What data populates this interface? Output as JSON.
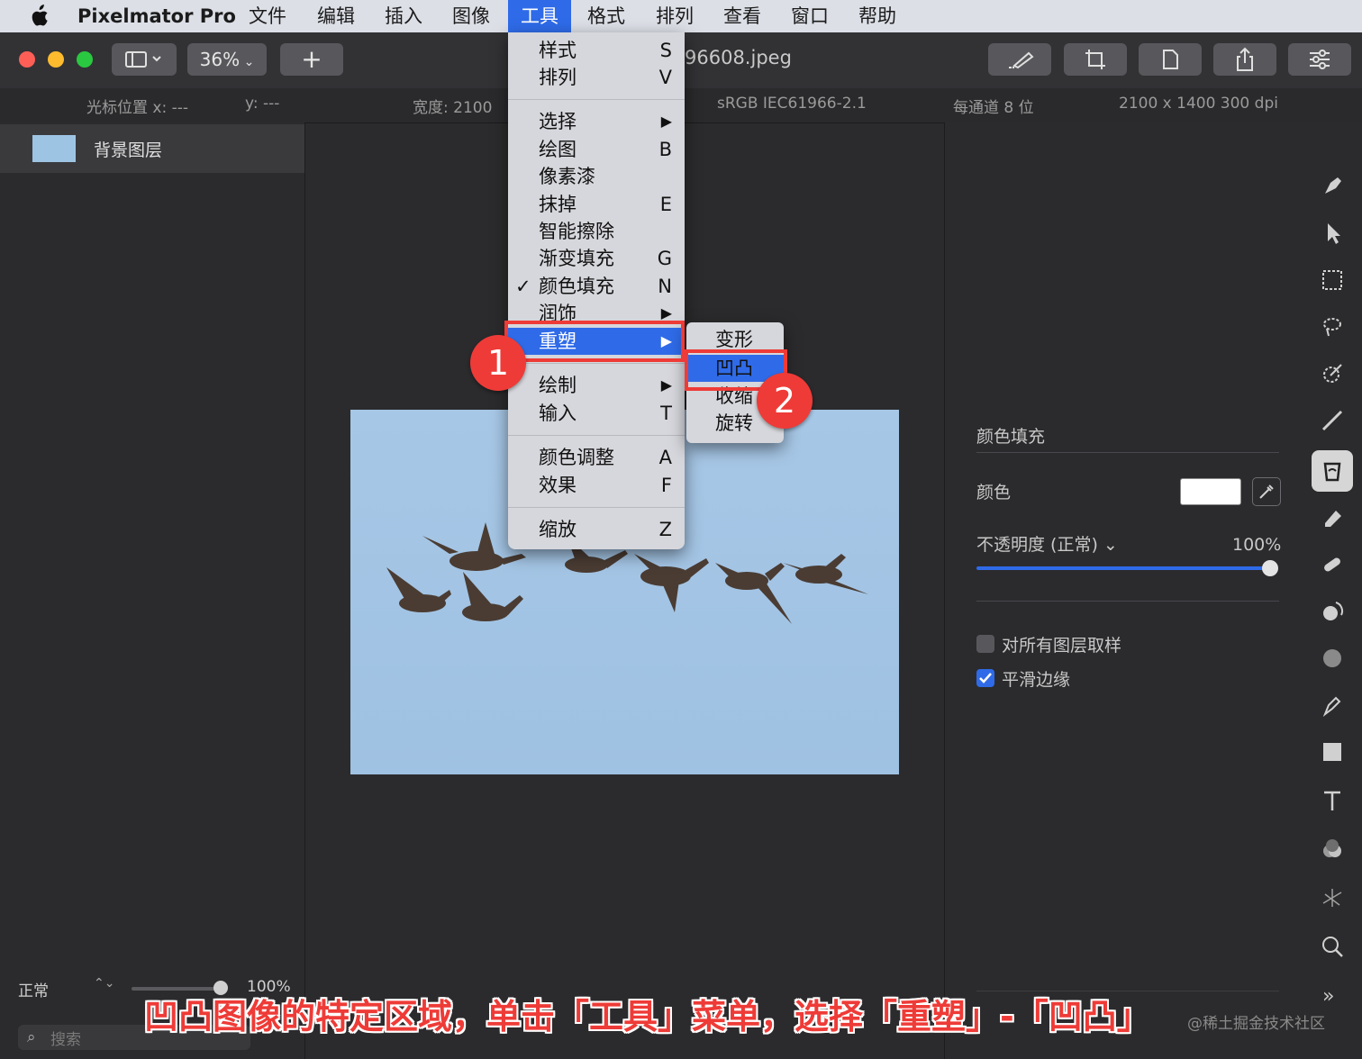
{
  "menubar": {
    "app_name": "Pixelmator Pro",
    "items": [
      "文件",
      "编辑",
      "插入",
      "图像",
      "工具",
      "格式",
      "排列",
      "查看",
      "窗口",
      "帮助"
    ],
    "active_item": "工具"
  },
  "toolbar": {
    "zoom": "36%",
    "add_label": "+",
    "filename": "96608.jpeg"
  },
  "infobar": {
    "cursor_x": "光标位置 x: ---",
    "cursor_y": "y: ---",
    "width": "宽度: 2100",
    "color_profile": "sRGB IEC61966-2.1",
    "bit_depth": "每通道 8 位",
    "dimensions": "2100 x 1400 300 dpi"
  },
  "layers": {
    "items": [
      {
        "name": "背景图层"
      }
    ],
    "blend_mode": "正常",
    "opacity": "100%",
    "search_placeholder": "搜索"
  },
  "tools_menu": {
    "items": [
      {
        "label": "样式",
        "shortcut": "S"
      },
      {
        "label": "排列",
        "shortcut": "V"
      },
      {
        "label": "选择",
        "shortcut": "▶"
      },
      {
        "label": "绘图",
        "shortcut": "B"
      },
      {
        "label": "像素漆",
        "shortcut": ""
      },
      {
        "label": "抹掉",
        "shortcut": "E"
      },
      {
        "label": "智能擦除",
        "shortcut": ""
      },
      {
        "label": "渐变填充",
        "shortcut": "G"
      },
      {
        "label": "颜色填充",
        "shortcut": "N",
        "checked": "✓"
      },
      {
        "label": "润饰",
        "shortcut": "▶"
      },
      {
        "label": "重塑",
        "shortcut": "▶"
      },
      {
        "label": "绘制",
        "shortcut": "▶"
      },
      {
        "label": "输入",
        "shortcut": "T"
      },
      {
        "label": "颜色调整",
        "shortcut": "A"
      },
      {
        "label": "效果",
        "shortcut": "F"
      },
      {
        "label": "缩放",
        "shortcut": "Z"
      }
    ]
  },
  "reshape_submenu": {
    "items": [
      "变形",
      "凹凸",
      "收缩",
      "旋转"
    ]
  },
  "right_panel": {
    "section_title": "颜色填充",
    "color_label": "颜色",
    "color_value": "#ffffff",
    "opacity_label": "不透明度 (正常) ⌄",
    "opacity_value": "100%",
    "opacity_fraction": 1.0,
    "sample_all_layers": "对所有图层取样",
    "sample_all_layers_checked": false,
    "smooth_edges": "平滑边缘",
    "smooth_edges_checked": true,
    "more": "»"
  },
  "annotations": {
    "badge_1": "1",
    "badge_2": "2",
    "caption": "凹凸图像的特定区域，单击「工具」菜单，选择「重塑」-「凹凸」",
    "watermark": "@稀土掘金技术社区"
  },
  "colors": {
    "accent": "#2f6be8",
    "annotation_red": "#ee3b37",
    "sky": "#a3c4e4"
  }
}
